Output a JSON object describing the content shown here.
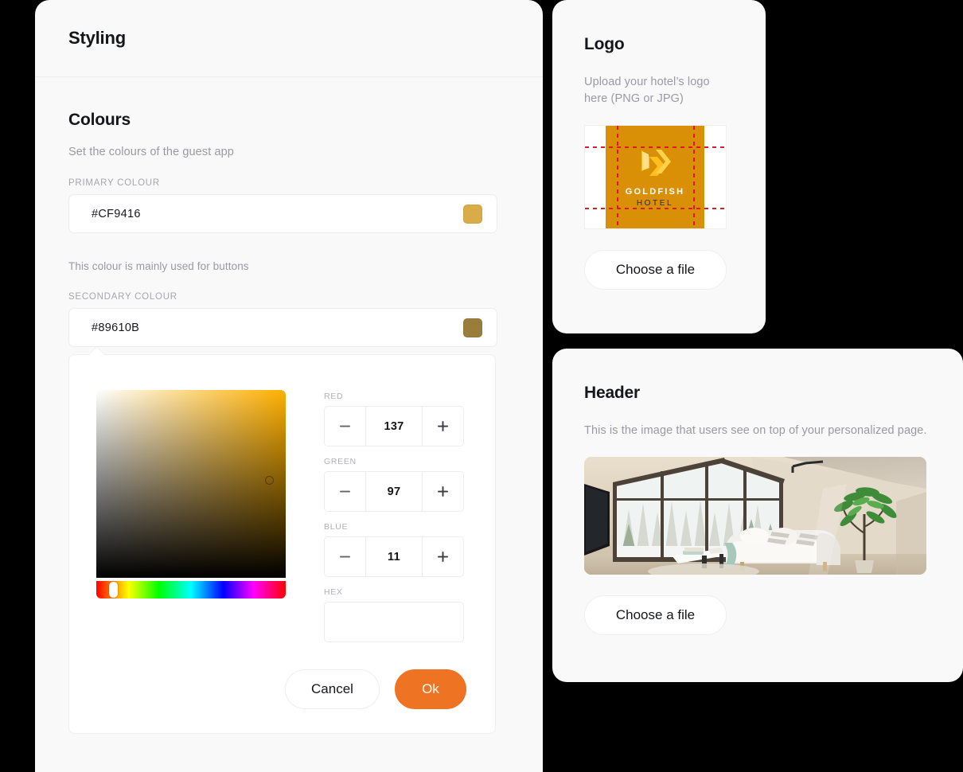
{
  "styling_panel": {
    "header_title": "Styling",
    "colours": {
      "section_title": "Colours",
      "subtitle": "Set the colours of the guest app",
      "primary": {
        "label": "PRIMARY COLOUR",
        "value": "#CF9416",
        "swatch_color": "#D9AC48",
        "helper": "This colour is mainly used for buttons"
      },
      "secondary": {
        "label": "SECONDARY COLOUR",
        "value": "#89610B",
        "swatch_color": "#9A7D3C"
      }
    },
    "picker": {
      "hue_color": "#FFB000",
      "channels": [
        {
          "label": "RED",
          "value": "137"
        },
        {
          "label": "GREEN",
          "value": "97"
        },
        {
          "label": "BLUE",
          "value": "11"
        }
      ],
      "hex": {
        "label": "HEX",
        "value": "",
        "placeholder": ""
      },
      "cancel_label": "Cancel",
      "ok_label": "Ok",
      "ok_color": "#EE7424",
      "minus_icon": "minus-icon",
      "plus_icon": "plus-icon"
    }
  },
  "logo_card": {
    "title": "Logo",
    "subtitle": "Upload your hotel’s logo here (PNG or JPG)",
    "preview": {
      "brand_name": "GOLDFISH",
      "brand_sub": "HOTEL",
      "background_color": "#D99006",
      "crop_guide_color": "#E8122B"
    },
    "choose_file_label": "Choose a file"
  },
  "header_card": {
    "title": "Header",
    "subtitle": "This is the image that users see on top of your personalized page.",
    "choose_file_label": "Choose a file"
  }
}
